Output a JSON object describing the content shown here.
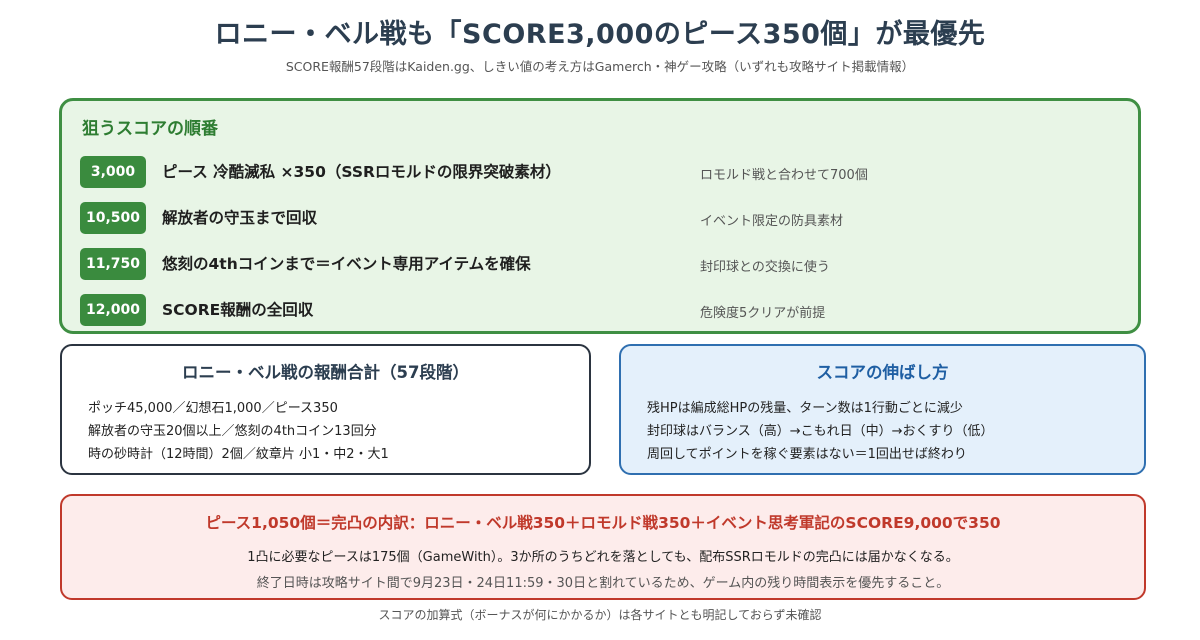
{
  "title": "ロニー・ベル戦も「SCORE3,000のピース350個」が最優先",
  "subtitle": "SCORE報酬57段階はKaiden.gg、しきい値の考え方はGamerch・神ゲー攻略（いずれも攻略サイト掲載情報）",
  "priority": {
    "heading": "狙うスコアの順番",
    "rows": [
      {
        "score": "3,000",
        "text": "ピース 冷酷滅私 ×350（SSRロモルドの限界突破素材）",
        "note": "ロモルド戦と合わせて700個"
      },
      {
        "score": "10,500",
        "text": "解放者の守玉まで回収",
        "note": "イベント限定の防具素材"
      },
      {
        "score": "11,750",
        "text": "悠刻の4thコインまで＝イベント専用アイテムを確保",
        "note": "封印球との交換に使う"
      },
      {
        "score": "12,000",
        "text": "SCORE報酬の全回収",
        "note": "危険度5クリアが前提"
      }
    ]
  },
  "rewards": {
    "heading": "ロニー・ベル戦の報酬合計（57段階）",
    "lines": [
      "ポッチ45,000／幻想石1,000／ピース350",
      "解放者の守玉20個以上／悠刻の4thコイン13回分",
      "時の砂時計（12時間）2個／紋章片 小1・中2・大1"
    ]
  },
  "growth": {
    "heading": "スコアの伸ばし方",
    "lines": [
      "残HPは編成総HPの残量、ターン数は1行動ごとに減少",
      "封印球はバランス（高）→こもれ日（中）→おくすり（低）",
      "周回してポイントを稼ぐ要素はない＝1回出せば終わり"
    ]
  },
  "breakdown": {
    "heading": "ピース1,050個＝完凸の内訳：ロニー・ベル戦350＋ロモルド戦350＋イベント思考軍記のSCORE9,000で350",
    "line1": "1凸に必要なピースは175個（GameWith）。3か所のうちどれを落としても、配布SSRロモルドの完凸には届かなくなる。",
    "line2": "終了日時は攻略サイト間で9月23日・24日11:59・30日と割れているため、ゲーム内の残り時間表示を優先すること。"
  },
  "footer": "スコアの加算式（ボーナスが何にかかるか）は各サイトとも明記しておらず未確認",
  "colors": {
    "priority_border": "#3f8f43",
    "priority_bg": "#e8f5e6",
    "badge": "#3a8b3e",
    "growth_border": "#2f6fb0",
    "growth_bg": "#e4f0fb",
    "breakdown_border": "#c0392b",
    "breakdown_bg": "#fdeceb"
  }
}
